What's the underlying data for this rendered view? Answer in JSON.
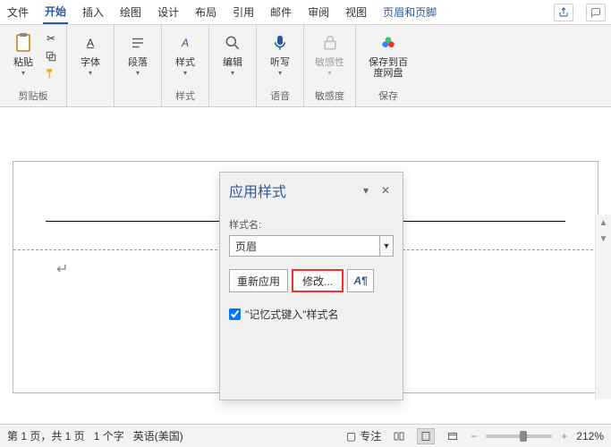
{
  "menubar": {
    "tabs": [
      "文件",
      "开始",
      "插入",
      "绘图",
      "设计",
      "布局",
      "引用",
      "邮件",
      "审阅",
      "视图",
      "页眉和页脚"
    ],
    "active_index": 1,
    "context_index": 10
  },
  "ribbon": {
    "clipboard": {
      "paste": "粘贴",
      "group": "剪贴板"
    },
    "font": {
      "label": "字体",
      "group": ""
    },
    "paragraph": {
      "label": "段落"
    },
    "styles": {
      "label": "样式",
      "group": "样式"
    },
    "editing": {
      "label": "编辑"
    },
    "dictate": {
      "label": "听写",
      "group": "语音"
    },
    "sensitivity": {
      "label": "敏感性",
      "group": "敏感度"
    },
    "save_baidu": {
      "label": "保存到百度网盘",
      "group": "保存"
    }
  },
  "pane": {
    "title": "应用样式",
    "field_label": "样式名:",
    "field_value": "页眉",
    "reapply": "重新应用",
    "modify": "修改...",
    "aa_icon": "A¶",
    "checkbox_label": "\"记忆式键入\"样式名",
    "checkbox_checked": true
  },
  "statusbar": {
    "page": "第 1 页，共 1 页",
    "words": "1 个字",
    "lang": "英语(美国)",
    "focus": "专注",
    "zoom": "212%"
  },
  "return_mark": "↵"
}
